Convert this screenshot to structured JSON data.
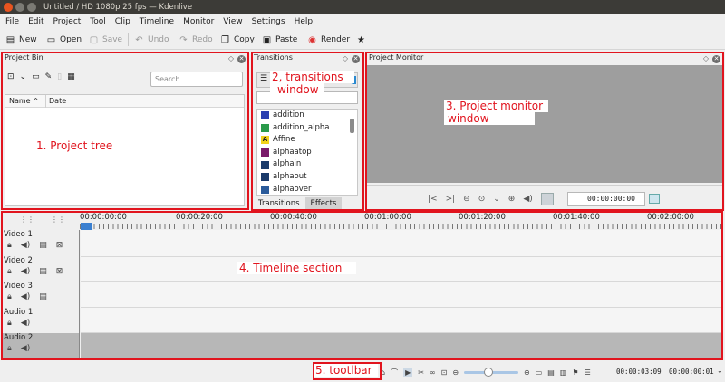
{
  "window": {
    "title": "Untitled / HD 1080p 25 fps — Kdenlive"
  },
  "menu": [
    "File",
    "Edit",
    "Project",
    "Tool",
    "Clip",
    "Timeline",
    "Monitor",
    "View",
    "Settings",
    "Help"
  ],
  "toolbar": {
    "new": "New",
    "open": "Open",
    "save": "Save",
    "undo": "Undo",
    "redo": "Redo",
    "copy": "Copy",
    "paste": "Paste",
    "render": "Render"
  },
  "project_bin": {
    "title": "Project Bin",
    "search_placeholder": "Search",
    "columns": [
      "Name",
      "Date"
    ]
  },
  "transitions": {
    "title": "Transitions",
    "items": [
      {
        "label": "addition",
        "icon_color": "#2a3fb0"
      },
      {
        "label": "addition_alpha",
        "icon_color": "#2a9a4a"
      },
      {
        "label": "Affine",
        "icon_color": "#f2d21b"
      },
      {
        "label": "alphaatop",
        "icon_color": "#7a1a6a"
      },
      {
        "label": "alphain",
        "icon_color": "#1a3a6a"
      },
      {
        "label": "alphaout",
        "icon_color": "#1a3a6a"
      },
      {
        "label": "alphaover",
        "icon_color": "#2a5a9a"
      }
    ],
    "tabs": [
      "Transitions",
      "Effects"
    ]
  },
  "monitor": {
    "title": "Project Monitor",
    "timecode": "00:00:00:00"
  },
  "timeline": {
    "ruler": [
      "00:00:00:00",
      "00:00:20:00",
      "00:00:40:00",
      "00:01:00:00",
      "00:01:20:00",
      "00:01:40:00",
      "00:02:00:00"
    ],
    "tracks": [
      "Video 1",
      "Video 2",
      "Video 3",
      "Audio 1",
      "Audio 2"
    ]
  },
  "status": {
    "timecode_1": "00:00:03:09",
    "timecode_2": "00:00:00:01"
  },
  "annotations": {
    "a1": "1. Project tree",
    "a2_line1": "2, transitions",
    "a2_line2": "window",
    "a3_line1": "3. Project monitor",
    "a3_line2": "window",
    "a4": "4. Timeline section",
    "a5": "5. tootlbar"
  },
  "colors": {
    "highlight": "#e1141e",
    "titlebar": "#3c3b37",
    "playhead": "#3a7fd0"
  }
}
